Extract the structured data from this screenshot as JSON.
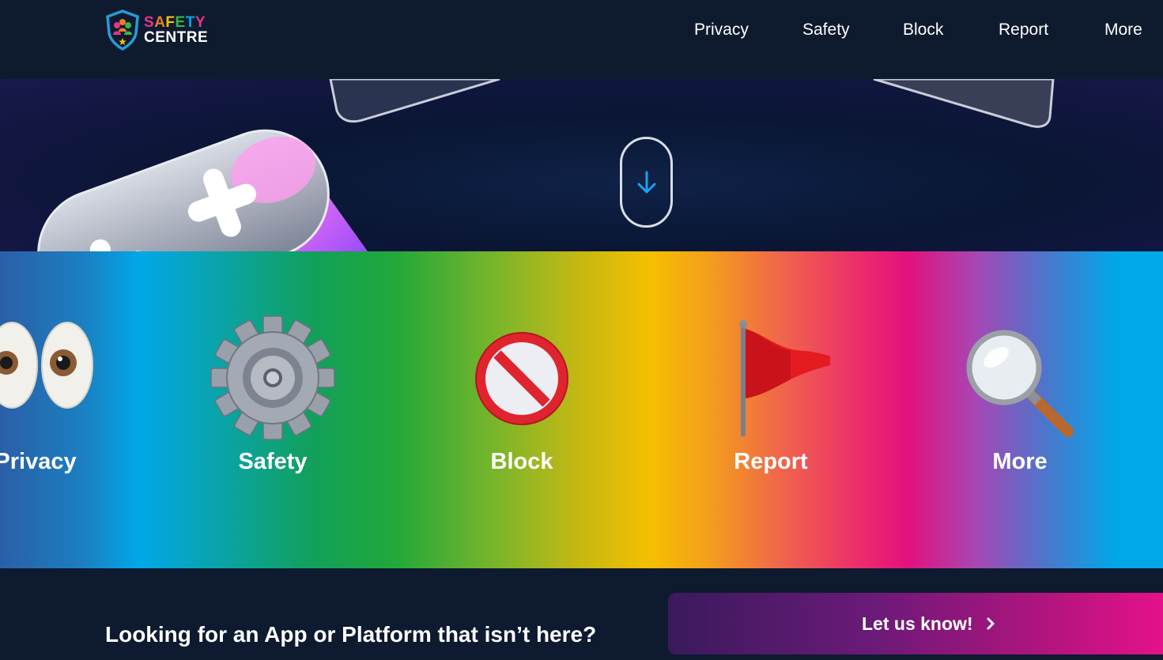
{
  "brand": {
    "line1_letters": [
      "S",
      "A",
      "F",
      "E",
      "T",
      "Y"
    ],
    "line1_colors": [
      "#e8338b",
      "#f07a2a",
      "#f6c200",
      "#3bb54a",
      "#00a8e8",
      "#e8338b"
    ],
    "line2": "CENTRE"
  },
  "nav": {
    "items": [
      {
        "label": "Privacy"
      },
      {
        "label": "Safety"
      },
      {
        "label": "Block"
      },
      {
        "label": "Report"
      },
      {
        "label": "More"
      }
    ]
  },
  "hero": {
    "scroll_icon": "arrow-down-icon"
  },
  "categories": [
    {
      "label": "Privacy",
      "icon": "eyes-icon"
    },
    {
      "label": "Safety",
      "icon": "gear-icon"
    },
    {
      "label": "Block",
      "icon": "no-entry-icon"
    },
    {
      "label": "Report",
      "icon": "red-flag-icon"
    },
    {
      "label": "More",
      "icon": "magnifying-glass-icon"
    }
  ],
  "footer": {
    "question": "Looking for an App or Platform that isn’t here?",
    "cta_label": "Let us know!",
    "cta_icon": "chevron-right-icon"
  },
  "colors": {
    "header_bg": "#0e1b2f",
    "accent_blue": "#00a8e8",
    "cta_pink": "#e9118b"
  }
}
